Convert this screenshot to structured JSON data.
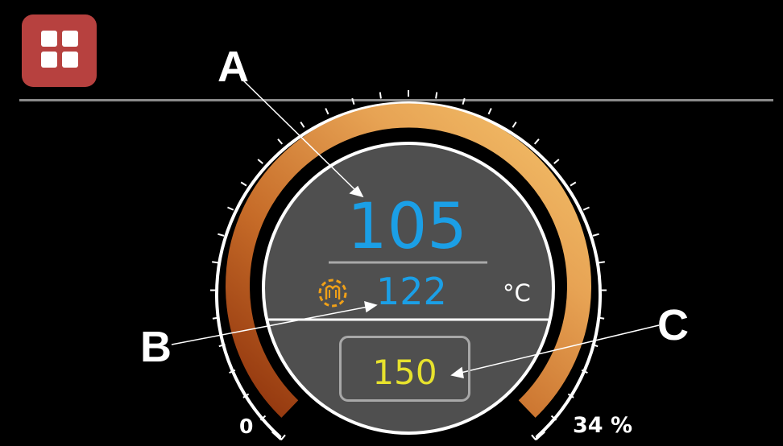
{
  "toolbar": {
    "menu_icon": "grid-icon"
  },
  "gauge": {
    "current_temperature": "105",
    "secondary_temperature": "122",
    "heating_icon": "heater-icon",
    "unit": "°C",
    "setpoint": "150",
    "scale_min": "0",
    "scale_max": "34 %",
    "power_level_percent": 34
  },
  "callouts": {
    "a": "A",
    "b": "B",
    "c": "C"
  },
  "colors": {
    "current_temperature": "#1b9fe6",
    "setpoint": "#e7e22d",
    "menu_button": "#b7413f",
    "arc_start": "#8e320c",
    "arc_end": "#f4c26b",
    "heating_icon": "#f0a018"
  }
}
